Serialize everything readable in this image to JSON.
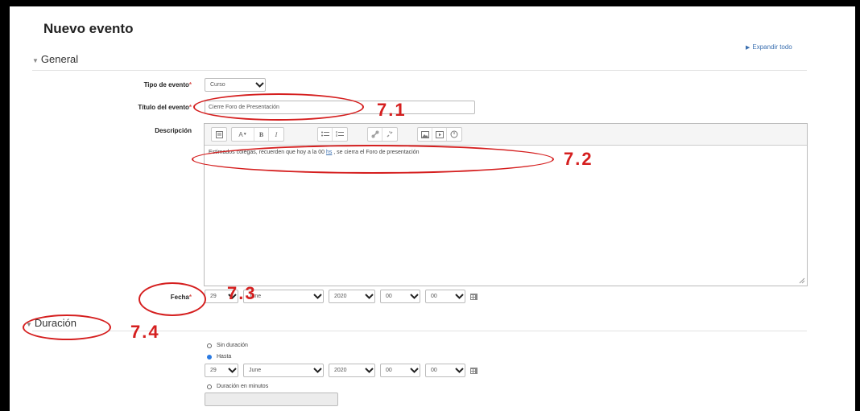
{
  "page": {
    "title": "Nuevo evento",
    "expand_all": "Expandir todo"
  },
  "general": {
    "section_label": "General",
    "event_type": {
      "label": "Tipo de evento",
      "required_mark": "*",
      "value": "Curso"
    },
    "event_title": {
      "label": "Título del evento",
      "required_mark": "*",
      "value": "Cierre Foro de Presentación"
    },
    "description": {
      "label": "Descripción",
      "text_before": "Estimados colegas, recuerden que hoy   a la 00 ",
      "text_link": "hs",
      "text_after": " , se cierra el Foro de presentación",
      "toolbar_icons": [
        "collapse-icon",
        "font-style-icon",
        "bold-icon",
        "italic-icon",
        "bullet-list-icon",
        "numbered-list-icon",
        "link-icon",
        "unlink-icon",
        "image-icon",
        "media-icon",
        "record-icon"
      ],
      "toolbar_glyphs": {
        "font": "A",
        "bold": "B",
        "italic": "I"
      }
    },
    "date": {
      "label": "Fecha",
      "required_mark": "*",
      "day": "29",
      "month": "June",
      "year": "2020",
      "hour": "00",
      "minute": "00"
    }
  },
  "duration": {
    "section_label": "Duración",
    "options": [
      {
        "label": "Sin duración",
        "selected": false
      },
      {
        "label": "Hasta",
        "selected": true
      },
      {
        "label": "Duración en minutos",
        "selected": false
      }
    ],
    "until": {
      "day": "29",
      "month": "June",
      "year": "2020",
      "hour": "00",
      "minute": "00"
    },
    "minutes_value": ""
  },
  "annotations": [
    "7.1",
    "7.2",
    "7.3",
    "7.4"
  ],
  "colors": {
    "annotation": "#d51f1f",
    "link": "#3a6fb0",
    "radio_on": "#2a7ae2",
    "required": "#d9534f"
  }
}
